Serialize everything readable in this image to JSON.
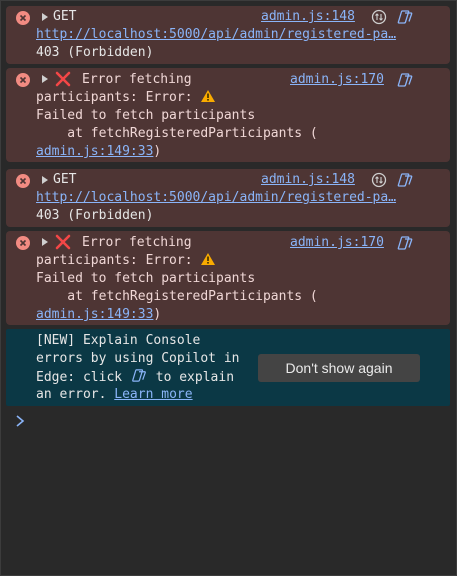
{
  "messages": [
    {
      "kind": "network",
      "method": "GET",
      "source": "admin.js:148",
      "url": "http://localhost:5000/api/admin/registered-pa…",
      "status": "403 (Forbidden)"
    },
    {
      "kind": "exception",
      "line1": "Error fetching",
      "source": "admin.js:170",
      "line2": "participants: Error:",
      "line3": "Failed to fetch participants",
      "line4": "    at fetchRegisteredParticipants (",
      "stack_link": "admin.js:149:33",
      "stack_close": ")"
    },
    {
      "kind": "network",
      "method": "GET",
      "source": "admin.js:148",
      "url": "http://localhost:5000/api/admin/registered-pa…",
      "status": "403 (Forbidden)"
    },
    {
      "kind": "exception",
      "line1": "Error fetching",
      "source": "admin.js:170",
      "line2": "participants: Error:",
      "line3": "Failed to fetch participants",
      "line4": "    at fetchRegisteredParticipants (",
      "stack_link": "admin.js:149:33",
      "stack_close": ")"
    }
  ],
  "banner": {
    "line1": "[NEW] Explain Console",
    "line2": "errors by using Copilot in",
    "line3_a": "Edge: click",
    "line3_b": "to explain",
    "line4": "an error.",
    "learn_more": "Learn more",
    "dismiss": "Don't show again"
  },
  "colors": {
    "background": "#292929",
    "error_bg": "#4e3534",
    "banner_bg": "#0b3845",
    "link": "#8ab4f8",
    "error_icon": "#f28b82",
    "warning": "#f9ab00"
  },
  "icons": {
    "error": "error-circle-icon",
    "expand": "expand-triangle-icon",
    "exception": "red-x-icon",
    "warning": "warning-icon",
    "network": "network-request-icon",
    "copilot": "copilot-icon",
    "prompt": "console-prompt-chevron-icon"
  }
}
